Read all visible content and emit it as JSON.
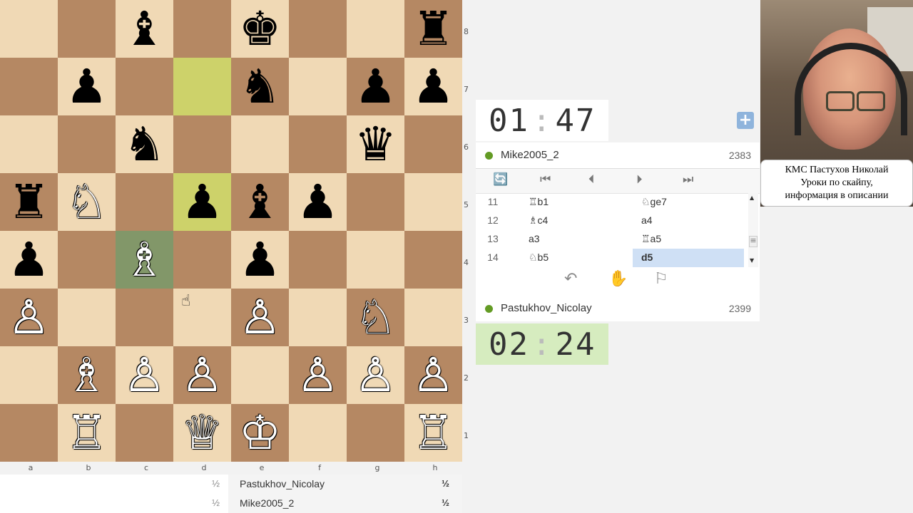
{
  "board": {
    "squares": [
      [
        "",
        "",
        "♝",
        "",
        "♚",
        "",
        "",
        "♜"
      ],
      [
        "",
        "♟",
        "",
        "",
        "♞",
        "",
        "♟",
        "♟"
      ],
      [
        "",
        "",
        "♞",
        "",
        "",
        "",
        "♛",
        ""
      ],
      [
        "♜",
        "♘",
        "",
        "♟",
        "♝",
        "♟",
        "",
        ""
      ],
      [
        "♟",
        "",
        "♗",
        "",
        "♟",
        "",
        "",
        ""
      ],
      [
        "♙",
        "",
        "",
        "",
        "♙",
        "",
        "♘",
        ""
      ],
      [
        "",
        "♗",
        "♙",
        "♙",
        "",
        "♙",
        "♙",
        "♙"
      ],
      [
        "",
        "♖",
        "",
        "♕",
        "♔",
        "",
        "",
        "♖"
      ]
    ],
    "ranks": [
      "8",
      "7",
      "6",
      "5",
      "4",
      "3",
      "2",
      "1"
    ],
    "files": [
      "a",
      "b",
      "c",
      "d",
      "e",
      "f",
      "g",
      "h"
    ],
    "highlight_move_squares": [
      "d7",
      "d5"
    ],
    "selected_square": "c4",
    "colors": {
      "light": "#f0d9b5",
      "dark": "#b58863",
      "last_move": "#cdd26a",
      "selected": "#829769"
    }
  },
  "results": [
    {
      "left_score": "½",
      "name": "Pastukhov_Nicolay",
      "right_score": "½"
    },
    {
      "left_score": "½",
      "name": "Mike2005_2",
      "right_score": "½"
    }
  ],
  "clock_top": {
    "minutes": "01",
    "seconds": "47"
  },
  "clock_bottom": {
    "minutes": "02",
    "seconds": "24"
  },
  "plus_label": "+",
  "player_top": {
    "name": "Mike2005_2",
    "rating": "2383"
  },
  "player_bottom": {
    "name": "Pastukhov_Nicolay",
    "rating": "2399"
  },
  "controls": {
    "flip": "🔄",
    "first": "⏮",
    "prev": "⏮",
    "next": "⏭",
    "last": "⏭"
  },
  "moves": [
    {
      "num": "11",
      "white": "♖b1",
      "black": "♘ge7",
      "active": ""
    },
    {
      "num": "12",
      "white": "♗c4",
      "black": "a4",
      "active": ""
    },
    {
      "num": "13",
      "white": "a3",
      "black": "♖a5",
      "active": ""
    },
    {
      "num": "14",
      "white": "♘b5",
      "black": "d5",
      "active": "black"
    }
  ],
  "actions": {
    "takeback": "↶",
    "offer_draw": "✋",
    "resign": "⚐"
  },
  "scroll": {
    "up": "▲",
    "down": "▼",
    "grip": "≡"
  },
  "webcam_caption": [
    "КМС Пастухов Николай",
    "Уроки по скайпу,",
    "информация в описании"
  ],
  "cursor": "☝"
}
